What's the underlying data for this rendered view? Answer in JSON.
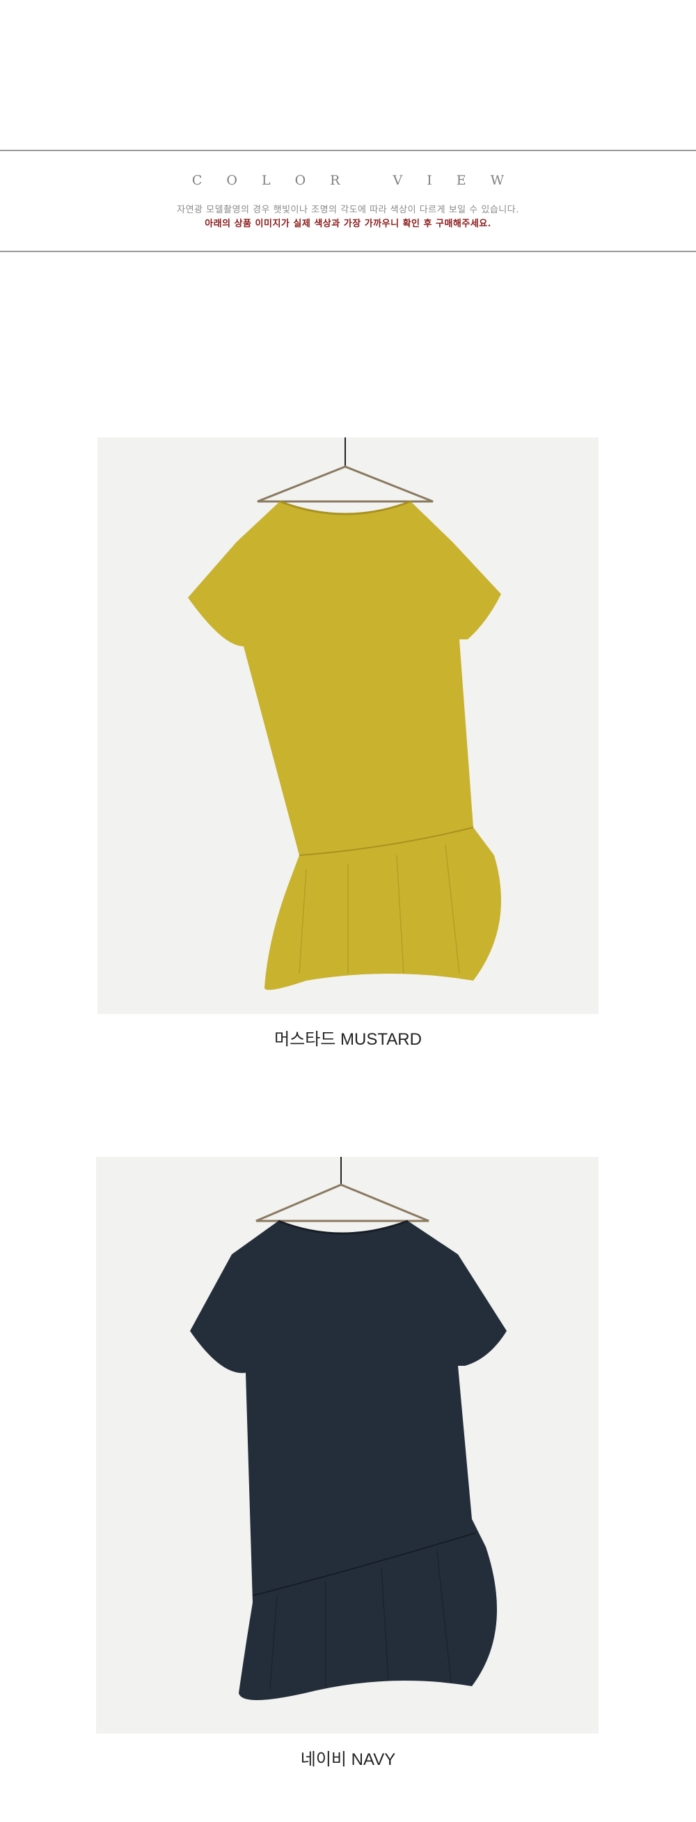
{
  "header": {
    "title": "COLOR VIEW",
    "note": "자연광 모델촬영의 경우 햇빛이나 조명의 각도에 따라 색상이 다르게 보일 수 있습니다.",
    "warning": "아래의 상품 이미지가 실제 색상과 가장 가까우니 확인 후 구매해주세요."
  },
  "products": [
    {
      "caption": "머스타드 MUSTARD",
      "color": "#c9b22e",
      "shade": "#a8921f"
    },
    {
      "caption": "네이비 NAVY",
      "color": "#242e3a",
      "shade": "#161d26"
    }
  ]
}
